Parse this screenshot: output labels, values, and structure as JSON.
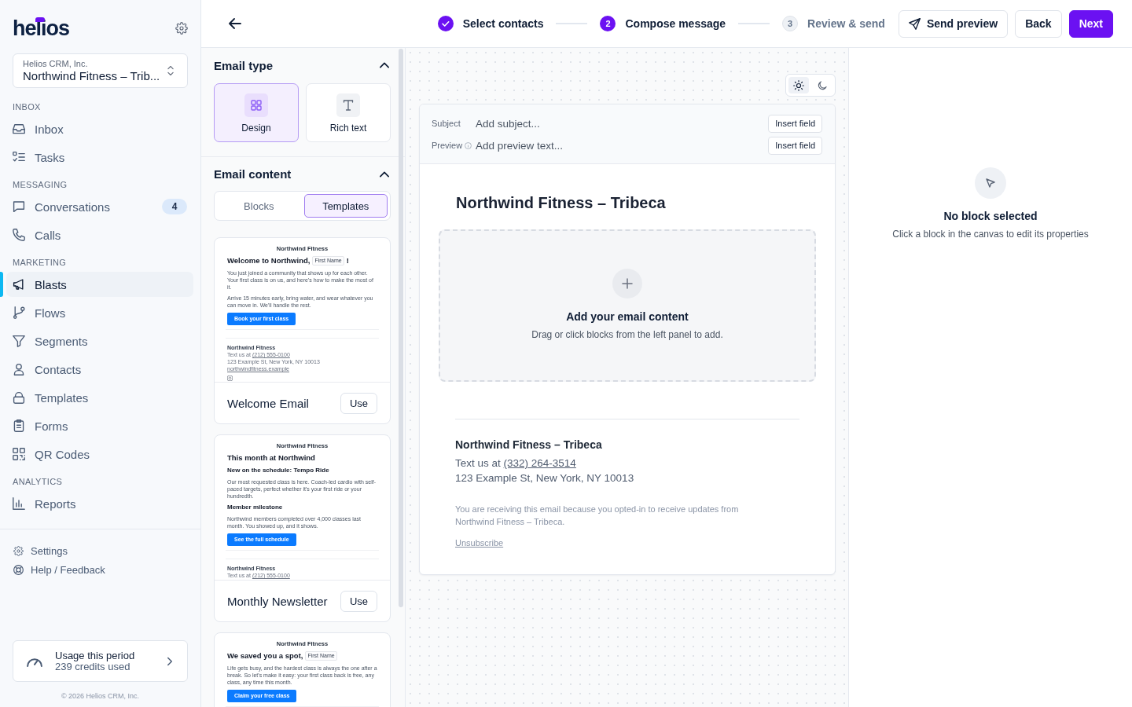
{
  "sidebar": {
    "logo": "helios",
    "workspace": {
      "organization": "Helios CRM, Inc.",
      "location": "Northwind Fitness – Trib..."
    },
    "sections": [
      {
        "heading": "INBOX",
        "items": [
          {
            "label": "Inbox",
            "selected": false
          },
          {
            "label": "Tasks",
            "selected": false
          }
        ]
      },
      {
        "heading": "MESSAGING",
        "items": [
          {
            "label": "Conversations",
            "badge": "4",
            "selected": false
          },
          {
            "label": "Calls",
            "selected": false
          }
        ]
      },
      {
        "heading": "MARKETING",
        "items": [
          {
            "label": "Blasts",
            "selected": true
          },
          {
            "label": "Flows",
            "selected": false
          },
          {
            "label": "Segments",
            "selected": false
          },
          {
            "label": "Contacts",
            "selected": false
          },
          {
            "label": "Templates",
            "selected": false
          },
          {
            "label": "Forms",
            "selected": false
          },
          {
            "label": "QR Codes",
            "selected": false
          }
        ]
      },
      {
        "heading": "ANALYTICS",
        "items": [
          {
            "label": "Reports",
            "selected": false
          }
        ]
      }
    ],
    "utility_links": [
      {
        "label": "Settings"
      },
      {
        "label": "Help / Feedback"
      }
    ],
    "usage": {
      "title": "Usage this period",
      "detail": "239 credits used"
    },
    "copyright": "© 2026 Helios CRM, Inc."
  },
  "header": {
    "steps": [
      {
        "label": "Select contacts",
        "completed": true,
        "selected": false
      },
      {
        "number": "2",
        "label": "Compose message",
        "completed": false,
        "selected": true
      },
      {
        "number": "3",
        "label": "Review & send",
        "completed": false,
        "selected": false
      }
    ],
    "actions": [
      {
        "label": "Send preview",
        "kind": "send"
      },
      {
        "label": "Back",
        "kind": "secondary"
      },
      {
        "label": "Next",
        "kind": "primary"
      }
    ]
  },
  "left_panel": {
    "email_type": {
      "title": "Email type",
      "expanded": true,
      "options": [
        {
          "label": "Design",
          "selected": true
        },
        {
          "label": "Rich text",
          "selected": false
        }
      ]
    },
    "email_content": {
      "title": "Email content",
      "expanded": true,
      "tabs": [
        {
          "label": "Blocks",
          "selected": false
        },
        {
          "label": "Templates",
          "selected": true
        }
      ],
      "templates": [
        {
          "name": "Welcome Email",
          "action": "Use",
          "preview": [
            {
              "kind": "brand",
              "text": "Northwind Fitness"
            },
            {
              "kind": "heading",
              "text": "Welcome to Northwind,",
              "merge_tag": "First Name",
              "suffix": "!"
            },
            {
              "kind": "paragraph",
              "text": "You just joined a community that shows up for each other. Your first class is on us, and here's how to make the most of it."
            },
            {
              "kind": "paragraph",
              "text": "Arrive 15 minutes early, bring water, and wear whatever you can move in. We'll handle the rest."
            },
            {
              "kind": "button",
              "text": "Book your first class"
            },
            {
              "kind": "divider"
            },
            {
              "kind": "divider"
            },
            {
              "kind": "footer-title",
              "text": "Northwind Fitness"
            },
            {
              "kind": "contact",
              "text": "Text us at",
              "link": "(212) 555-0100"
            },
            {
              "kind": "footer-text",
              "text": "123 Example St, New York, NY 10013"
            },
            {
              "kind": "footer-link",
              "text": "northwindfitness.example"
            },
            {
              "kind": "social"
            }
          ]
        },
        {
          "name": "Monthly Newsletter",
          "action": "Use",
          "preview": [
            {
              "kind": "brand",
              "text": "Northwind Fitness"
            },
            {
              "kind": "heading",
              "text": "This month at Northwind"
            },
            {
              "kind": "subheading",
              "text": "New on the schedule: Tempo Ride"
            },
            {
              "kind": "paragraph",
              "text": "Our most requested class is here. Coach-led cardio with self-paced targets, perfect whether it's your first ride or your hundredth."
            },
            {
              "kind": "subheading",
              "text": "Member milestone"
            },
            {
              "kind": "paragraph",
              "text": "Northwind members completed over 4,000 classes last month. You showed up, and it shows."
            },
            {
              "kind": "button",
              "text": "See the full schedule"
            },
            {
              "kind": "divider"
            },
            {
              "kind": "divider"
            },
            {
              "kind": "footer-title",
              "text": "Northwind Fitness"
            },
            {
              "kind": "contact",
              "text": "Text us at",
              "link": "(212) 555-0100"
            }
          ]
        },
        {
          "preview": [
            {
              "kind": "brand",
              "text": "Northwind Fitness"
            },
            {
              "kind": "heading",
              "text": "We saved you a spot,",
              "merge_tag": "First Name"
            },
            {
              "kind": "paragraph",
              "text": "Life gets busy, and the hardest class is always the one after a break. So let's make it easy: your first class back is free, any class, any time this month."
            },
            {
              "kind": "button",
              "text": "Claim your free class"
            },
            {
              "kind": "divider"
            }
          ]
        }
      ]
    }
  },
  "canvas": {
    "theme_toggle": [
      {
        "selected": true
      },
      {
        "selected": false
      }
    ],
    "email": {
      "fields": [
        {
          "label": "Subject",
          "placeholder": "Add subject...",
          "info": false,
          "action": "Insert field"
        },
        {
          "label": "Preview",
          "placeholder": "Add preview text...",
          "info": true,
          "action": "Insert field"
        }
      ],
      "heading": "Northwind Fitness – Tribeca",
      "dropzone": {
        "title": "Add your email content",
        "hint": "Drag or click blocks from the left panel to add."
      },
      "footer": {
        "name": "Northwind Fitness – Tribeca",
        "contact": "Text us at",
        "phone": "(332) 264-3514",
        "address": "123 Example St, New York, NY 10013",
        "notice": "You are receiving this email because you opted-in to receive updates from Northwind Fitness – Tribeca.",
        "unsubscribe": "Unsubscribe"
      }
    }
  },
  "properties_panel": {
    "title": "No block selected",
    "hint": "Click a block in the canvas to edit its properties"
  }
}
